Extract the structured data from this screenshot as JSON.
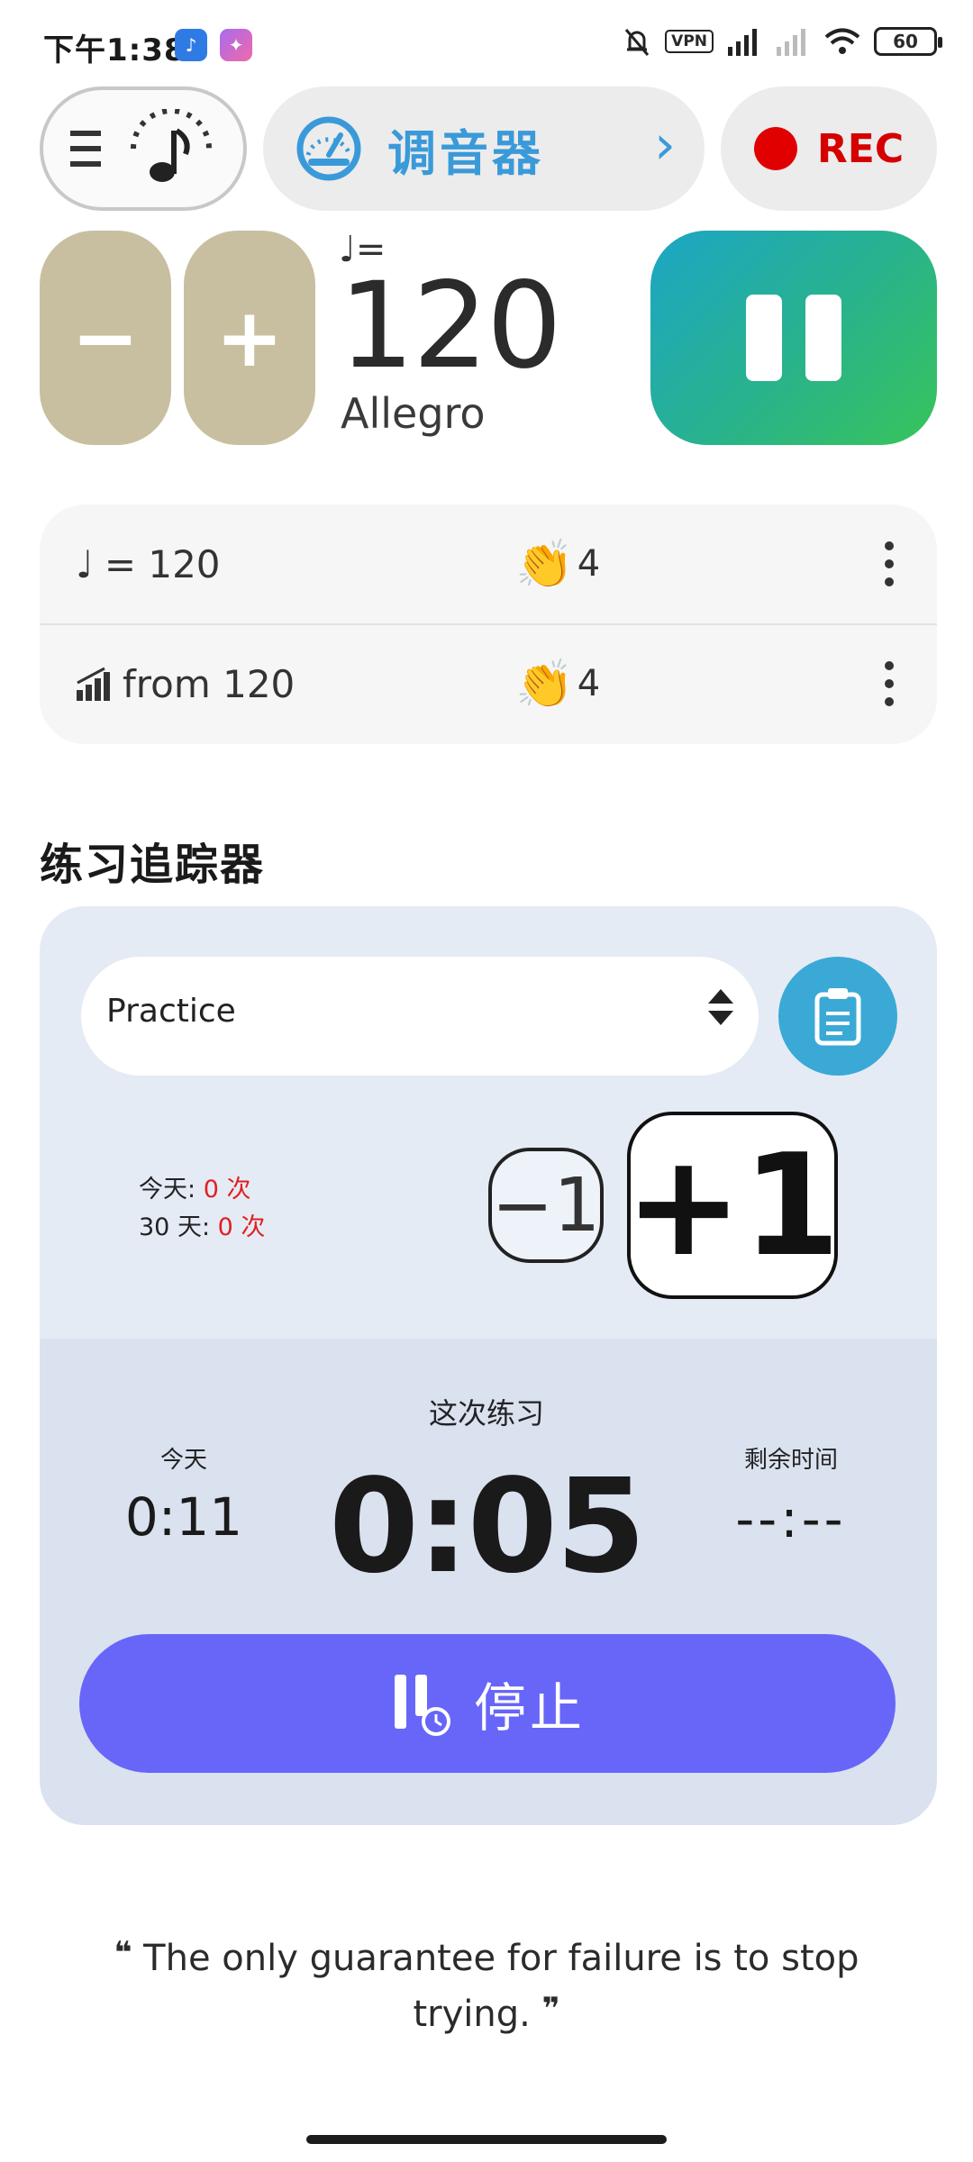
{
  "status_bar": {
    "time": "下午1:38",
    "vpn": "VPN",
    "battery": "60"
  },
  "header": {
    "tuner_label": "调音器",
    "rec_label": "REC"
  },
  "tempo": {
    "note_prefix": "♩=",
    "bpm": "120",
    "marking": "Allegro",
    "minus_label": "−",
    "plus_label": "+"
  },
  "presets": [
    {
      "label": "= 120",
      "beats": "4"
    },
    {
      "label": "from 120",
      "beats": "4"
    }
  ],
  "tracker": {
    "title": "练习追踪器",
    "select_value": "Practice",
    "today_prefix": "今天: ",
    "today_count": "0 次",
    "days30_prefix": "30 天: ",
    "days30_count": "0 次",
    "minus_one": "−1",
    "plus_one": "+1",
    "session_label": "这次练习",
    "session_time": "0:05",
    "today_label": "今天",
    "today_time": "0:11",
    "remaining_label": "剩余时间",
    "remaining_time": "--:--",
    "stop_label": "停止"
  },
  "quote": {
    "open": "❝",
    "text": "The only guarantee for failure is to stop trying.",
    "close": "❞"
  },
  "colors": {
    "accent_blue": "#3a9ad9",
    "rec_red": "#d50000",
    "step_button": "#c7bf9f",
    "stop_button": "#6766f8",
    "tracker_bg": "#e5ebf5"
  }
}
